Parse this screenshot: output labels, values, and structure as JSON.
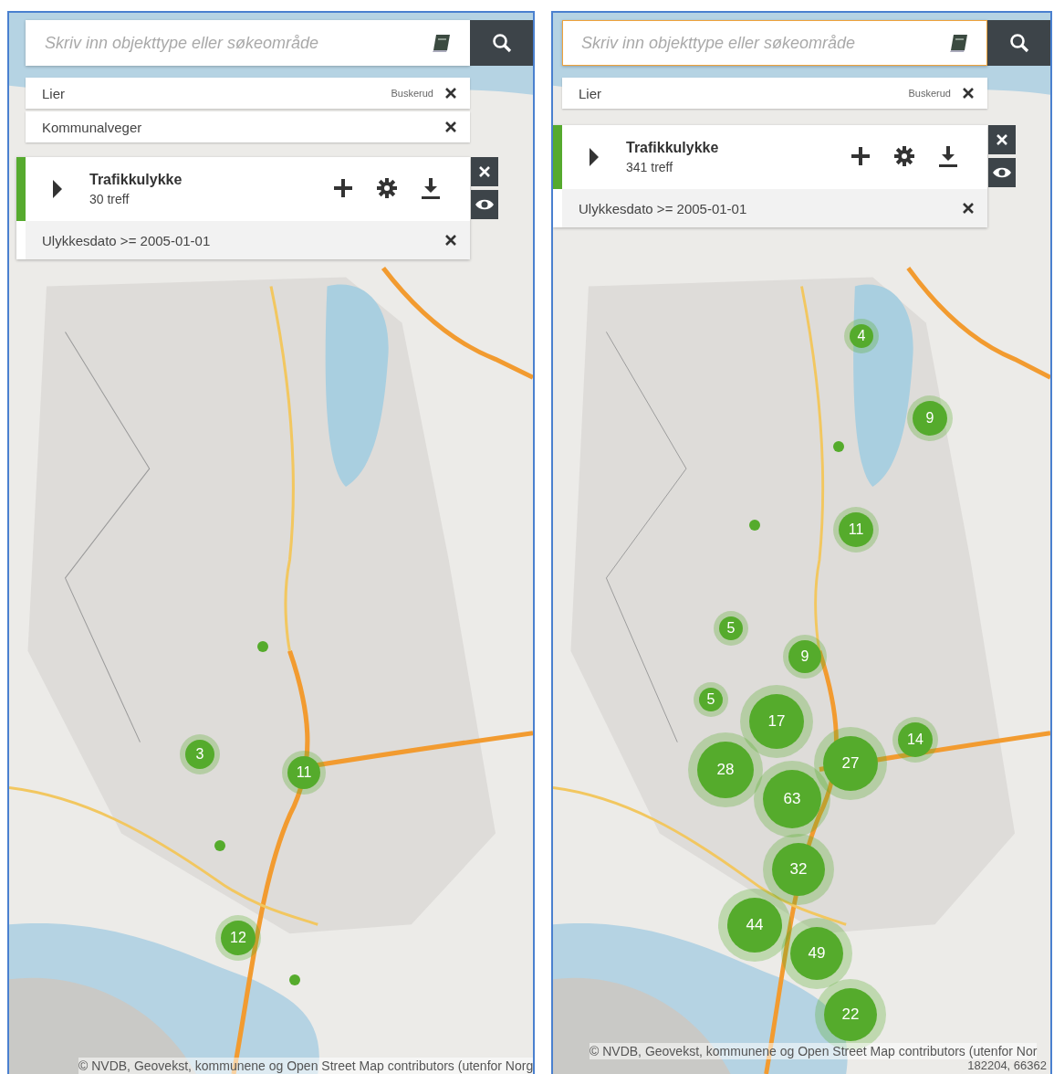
{
  "panels": [
    {
      "search": {
        "placeholder": "Skriv inn objekttype eller søkeområde",
        "focused": false
      },
      "chips": [
        {
          "label": "Lier",
          "sublabel": "Buskerud"
        },
        {
          "label": "Kommunalveger"
        }
      ],
      "layer": {
        "title": "Trafikkulykke",
        "count": "30 treff",
        "filter": "Ulykkesdato >= 2005-01-01"
      },
      "clusters": [
        {
          "kind": "dot"
        },
        {
          "kind": "cluster",
          "label": "3"
        },
        {
          "kind": "cluster",
          "label": "11"
        },
        {
          "kind": "dot"
        },
        {
          "kind": "cluster",
          "label": "12"
        },
        {
          "kind": "dot"
        }
      ],
      "attribution": "© NVDB, Geovekst, kommunene og Open Street Map contributors (utenfor Norg"
    },
    {
      "search": {
        "placeholder": "Skriv inn objekttype eller søkeområde",
        "focused": true
      },
      "chips": [
        {
          "label": "Lier",
          "sublabel": "Buskerud"
        }
      ],
      "layer": {
        "title": "Trafikkulykke",
        "count": "341 treff",
        "filter": "Ulykkesdato >= 2005-01-01"
      },
      "clusters": [
        {
          "kind": "cluster",
          "label": "4"
        },
        {
          "kind": "cluster",
          "label": "9"
        },
        {
          "kind": "dot"
        },
        {
          "kind": "dot"
        },
        {
          "kind": "cluster",
          "label": "11"
        },
        {
          "kind": "cluster",
          "label": "5"
        },
        {
          "kind": "cluster",
          "label": "9"
        },
        {
          "kind": "cluster",
          "label": "5"
        },
        {
          "kind": "cluster",
          "label": "17"
        },
        {
          "kind": "cluster",
          "label": "14"
        },
        {
          "kind": "cluster",
          "label": "27"
        },
        {
          "kind": "cluster",
          "label": "28"
        },
        {
          "kind": "cluster",
          "label": "63"
        },
        {
          "kind": "cluster",
          "label": "32"
        },
        {
          "kind": "cluster",
          "label": "44"
        },
        {
          "kind": "cluster",
          "label": "49"
        },
        {
          "kind": "cluster",
          "label": "22"
        }
      ],
      "attribution": "© NVDB, Geovekst, kommunene og Open Street Map contributors (utenfor Nor",
      "coordinates": "182204, 66362"
    }
  ]
}
